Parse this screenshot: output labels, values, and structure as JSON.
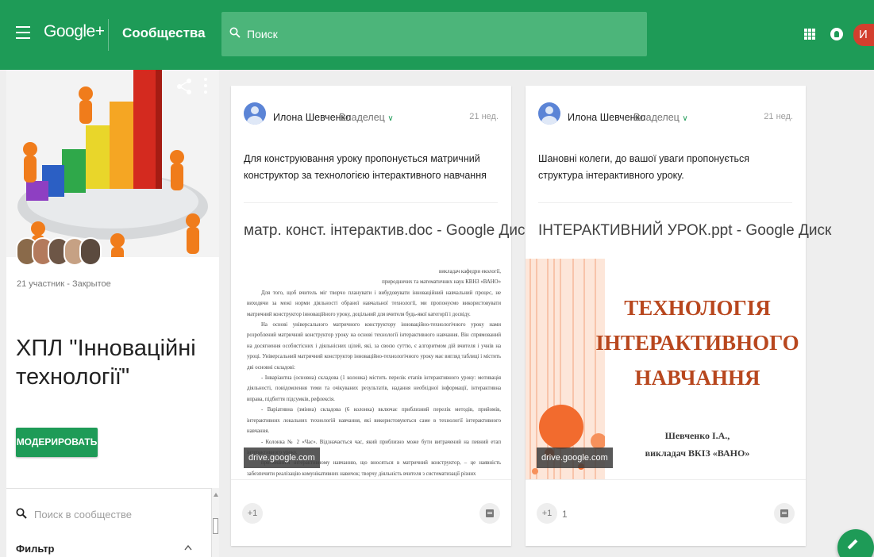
{
  "topbar": {
    "brand": "Google+",
    "section": "Сообщества",
    "search_placeholder": "Поиск",
    "user_initial": "И"
  },
  "community": {
    "members_text": "21 участник - Закрытое",
    "title": "ХПЛ \"Інноваційні технології\"",
    "moderate_label": "МОДЕРИРОВАТЬ",
    "search_placeholder": "Поиск в сообществе",
    "filter_label": "Фильтр"
  },
  "posts": [
    {
      "author": "Илона Шевченко",
      "role": "Владелец",
      "time": "21 нед.",
      "text": "Для конструювання уроку  пропонується матричний конструктор за технологією інтерактивного навчання",
      "link_title": "матр. конст. інтерактив.doc - Google Диск",
      "source": "drive.google.com",
      "plus_label": "+1",
      "plus_count": "",
      "doc": {
        "line1": "викладач кафедри екології,",
        "line2": "природничих та математичних наук КВНЗ «ВАНО»",
        "p1": "Для того, щоб вчитель міг творчо планувати і вибудовувати інноваційний навчальний процес, не виходячи за межі норми діяльності обраної навчальної технології, ми пропонуємо використовувати матричний конструктор інноваційного уроку, доцільний для вчителя будь-якої категорії і досвіду.",
        "p2": "На основі універсального матричного конструктору інноваційно-технологічного уроку нами розроблений матричний конструктор уроку на основі технології інтерактивного навчання. Він спрямований на досягнення особистісних і діяльнісних цілей, які, за своєю суттю, є алгоритмом дій вчителя і учнів на уроці. Універсальний матричний конструктор інноваційно-технологічного уроку має вигляд таблиці і містить дві основні складові:",
        "p3": "- Інваріантна (основна) складова (1 колонка) містить перелік етапів інтерактивного уроку: мотивація діяльності, повідомлення теми та очікуваних результатів, надання необхідної інформації, інтерактивна вправа, підбиття підсумків, рефлексія.",
        "p4": "- Варіативна (змінна) складова (6 колонка) включає приблизний перелік методів, прийомів, інтерактивних локальних технологій навчання, які використовуються саме в технології інтерактивного навчання.",
        "p5": "- Колонка № 2 «Час». Відзначається час, який приблизно може бути витрачений на певний етап інтерактивного уроку.",
        "p6": "притаманної інтерактивному навчанню, що вносяться в матричний конструктор, – це наявність забезпечити реалізацію комунікативних навичок; творчу діяльність вчителя з систематизації різних"
      }
    },
    {
      "author": "Илона Шевченко",
      "role": "Владелец",
      "time": "21 нед.",
      "text": "Шановні колеги, до вашої уваги пропонується структура інтерактивного уроку.",
      "link_title": "ІНТЕРАКТИВНИЙ УРОК.ppt - Google Диск",
      "source": "drive.google.com",
      "plus_label": "+1",
      "plus_count": "1",
      "slide": {
        "title_line1": "ТЕХНОЛОГІЯ",
        "title_line2": "ІНТЕРАКТИВНОГО",
        "title_line3": "НАВЧАННЯ",
        "author_line1": "Шевченко І.А.,",
        "author_line2": "викладач ВКІЗ «ВАНО»"
      }
    }
  ],
  "colors": {
    "brand_green": "#1e9b57",
    "avatar_red": "#d33f2e",
    "slide_orange": "#b8471e"
  }
}
